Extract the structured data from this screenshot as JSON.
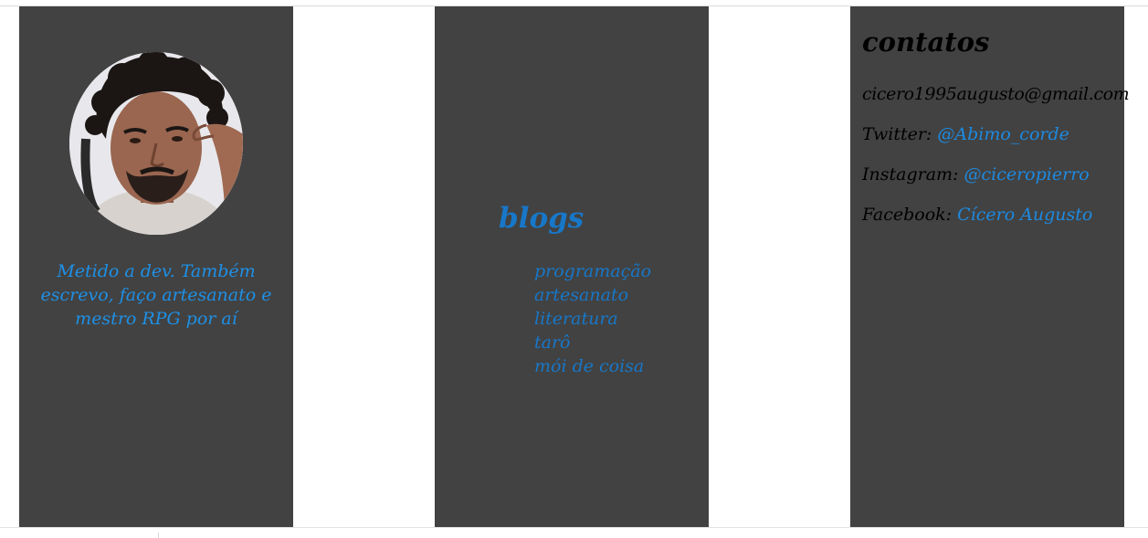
{
  "profile": {
    "avatar_alt": "profile photo",
    "bio": "Metido a dev. Também escrevo, faço artesanato e mestro RPG por aí"
  },
  "blogs": {
    "title": "blogs",
    "items": [
      {
        "label": "programação"
      },
      {
        "label": "artesanato"
      },
      {
        "label": "literatura"
      },
      {
        "label": "tarô"
      },
      {
        "label": "mói de coisa"
      }
    ]
  },
  "contacts": {
    "title": "contatos",
    "email": "cicero1995augusto@gmail.com",
    "twitter_label": "Twitter:",
    "twitter_handle": "@Abimo_corde",
    "instagram_label": "Instagram:",
    "instagram_handle": "@ciceropierro",
    "facebook_label": "Facebook:",
    "facebook_name": "Cícero Augusto"
  },
  "colors": {
    "column_bg": "#424242",
    "accent_blue": "#1877c8",
    "bio_blue": "#1e90e6",
    "page_bg": "#ffffff"
  }
}
